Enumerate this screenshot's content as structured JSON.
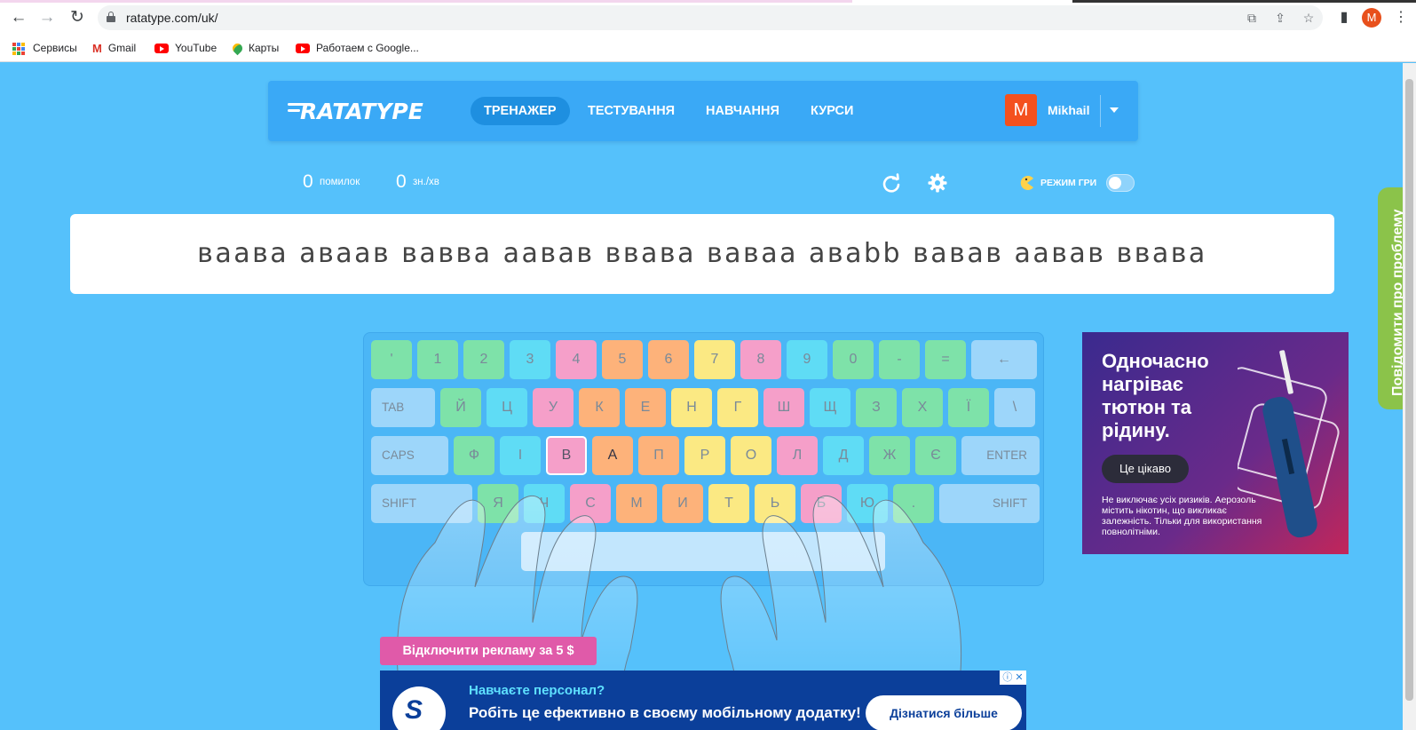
{
  "browser": {
    "url": "ratatype.com/uk/",
    "profile_initial": "M",
    "back_icon": "←",
    "forward_icon": "→",
    "reload_icon": "↻",
    "menu_icon": "⋮",
    "bookmarks": [
      {
        "label": "Сервисы",
        "icon": "apps-icon"
      },
      {
        "label": "Gmail",
        "icon": "gmail-icon"
      },
      {
        "label": "YouTube",
        "icon": "youtube-icon"
      },
      {
        "label": "Карты",
        "icon": "maps-icon"
      },
      {
        "label": "Работаем с Google...",
        "icon": "youtube-icon"
      }
    ]
  },
  "header": {
    "logo": "RATATYPE",
    "nav": [
      {
        "label": "ТРЕНАЖЕР",
        "active": true
      },
      {
        "label": "ТЕСТУВАННЯ",
        "active": false
      },
      {
        "label": "НАВЧАННЯ",
        "active": false
      },
      {
        "label": "КУРСИ",
        "active": false
      }
    ],
    "user_initial": "M",
    "user_name": "Mikhail"
  },
  "stats": {
    "errors_value": "0",
    "errors_label": "помилок",
    "speed_value": "0",
    "speed_label": "зн./хв",
    "game_mode_label": "РЕЖИМ ГРИ",
    "game_mode_on": false
  },
  "exercise": {
    "text": "ваава аваав вавва аавав ввава вавaа аваbb вавав аавав ввава"
  },
  "keyboard": {
    "colors": {
      "green": "#7ee2a9",
      "cyan": "#5fdcf5",
      "pink": "#f59fc9",
      "orange": "#fdb27a",
      "yellow": "#fbe983",
      "blue": "#9dd6fa",
      "space": "#c2e6fd"
    },
    "rows": [
      [
        {
          "label": "'",
          "c": "green"
        },
        {
          "label": "1",
          "c": "green"
        },
        {
          "label": "2",
          "c": "green"
        },
        {
          "label": "3",
          "c": "cyan"
        },
        {
          "label": "4",
          "c": "pink"
        },
        {
          "label": "5",
          "c": "orange"
        },
        {
          "label": "6",
          "c": "orange"
        },
        {
          "label": "7",
          "c": "yellow"
        },
        {
          "label": "8",
          "c": "pink"
        },
        {
          "label": "9",
          "c": "cyan"
        },
        {
          "label": "0",
          "c": "green"
        },
        {
          "label": "-",
          "c": "green"
        },
        {
          "label": "=",
          "c": "green"
        },
        {
          "label": "←",
          "c": "blue",
          "w": "wide"
        }
      ],
      [
        {
          "label": "TAB",
          "c": "blue",
          "w": "tab"
        },
        {
          "label": "Й",
          "c": "green"
        },
        {
          "label": "Ц",
          "c": "cyan"
        },
        {
          "label": "У",
          "c": "pink"
        },
        {
          "label": "К",
          "c": "orange"
        },
        {
          "label": "Е",
          "c": "orange"
        },
        {
          "label": "Н",
          "c": "yellow"
        },
        {
          "label": "Г",
          "c": "yellow"
        },
        {
          "label": "Ш",
          "c": "pink"
        },
        {
          "label": "Щ",
          "c": "cyan"
        },
        {
          "label": "З",
          "c": "green"
        },
        {
          "label": "Х",
          "c": "green"
        },
        {
          "label": "Ї",
          "c": "green"
        },
        {
          "label": "\\",
          "c": "blue"
        }
      ],
      [
        {
          "label": "CAPS",
          "c": "blue",
          "w": "caps"
        },
        {
          "label": "Ф",
          "c": "green"
        },
        {
          "label": "І",
          "c": "cyan"
        },
        {
          "label": "В",
          "c": "pink",
          "target": true
        },
        {
          "label": "А",
          "c": "orange",
          "next": true
        },
        {
          "label": "П",
          "c": "orange"
        },
        {
          "label": "Р",
          "c": "yellow"
        },
        {
          "label": "О",
          "c": "yellow"
        },
        {
          "label": "Л",
          "c": "pink"
        },
        {
          "label": "Д",
          "c": "cyan"
        },
        {
          "label": "Ж",
          "c": "green"
        },
        {
          "label": "Є",
          "c": "green"
        },
        {
          "label": "ENTER",
          "c": "blue",
          "w": "enter"
        }
      ],
      [
        {
          "label": "SHIFT",
          "c": "blue",
          "w": "lshift"
        },
        {
          "label": "Я",
          "c": "green"
        },
        {
          "label": "Ч",
          "c": "cyan"
        },
        {
          "label": "С",
          "c": "pink"
        },
        {
          "label": "М",
          "c": "orange"
        },
        {
          "label": "И",
          "c": "orange"
        },
        {
          "label": "Т",
          "c": "yellow"
        },
        {
          "label": "Ь",
          "c": "yellow"
        },
        {
          "label": "Б",
          "c": "pink"
        },
        {
          "label": "Ю",
          "c": "cyan"
        },
        {
          "label": ".",
          "c": "green"
        },
        {
          "label": "SHIFT",
          "c": "blue",
          "w": "rshift"
        }
      ]
    ]
  },
  "ads": {
    "right": {
      "title": "Одночасно нагріває тютюн та рідину.",
      "button": "Це цікаво",
      "disclaimer": "Не виключає усіх ризиків. Аерозоль містить нікотин, що викликає залежність. Тільки для використання повнолітніми."
    },
    "remove_ads": "Відключити рекламу за 5 $",
    "bottom": {
      "line1": "Навчаєте персонал?",
      "line2": "Робіть це ефективно в своєму мобільному додатку!",
      "button": "Дізнатися більше",
      "close": "ⓘ ✕"
    },
    "report_tab": "Повідомити про проблему"
  }
}
